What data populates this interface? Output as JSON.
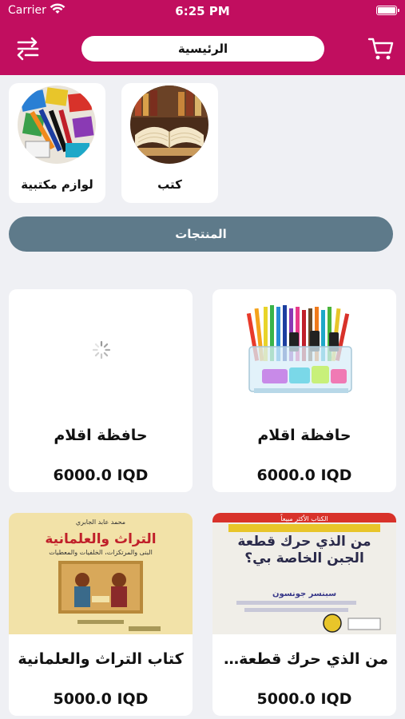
{
  "status_bar": {
    "carrier": "Carrier",
    "time": "6:25 PM"
  },
  "header": {
    "title": "الرئيسية",
    "menu_icon": "menu-swap-icon",
    "cart_icon": "cart-icon"
  },
  "categories": [
    {
      "label": "كتب",
      "image": "books-photo"
    },
    {
      "label": "لوازم مكتبية",
      "image": "stationery-photo"
    }
  ],
  "section_title": "المنتجات",
  "products": [
    {
      "name": "حافظة اقلام",
      "price": "6000.0 IQD",
      "image": "pencil-holder-photo"
    },
    {
      "name": "حافظة اقلام",
      "price": "6000.0 IQD",
      "image": "loading-spinner"
    },
    {
      "name": "من الذي حرك قطعة ا...",
      "price": "5000.0 IQD",
      "image": "book-cover-cheese"
    },
    {
      "name": "كتاب التراث والعلمانية",
      "price": "5000.0 IQD",
      "image": "book-cover-heritage"
    }
  ],
  "book_covers": {
    "cheese": {
      "top_banner": "الكتاب الأكثر مبيعاً",
      "title": "من الذي حرك قطعة الجبن الخاصة بي؟",
      "author": "سبنسر جونسون"
    },
    "heritage": {
      "author": "محمد عابد الجابري",
      "title": "التراث والعلمانية",
      "subtitle": "البنى والمرتكزات، الخلفيات والمعطيات"
    }
  },
  "colors": {
    "brand": "#c10e5f",
    "section_bar": "#5e7a8a",
    "background": "#eff0f4"
  }
}
